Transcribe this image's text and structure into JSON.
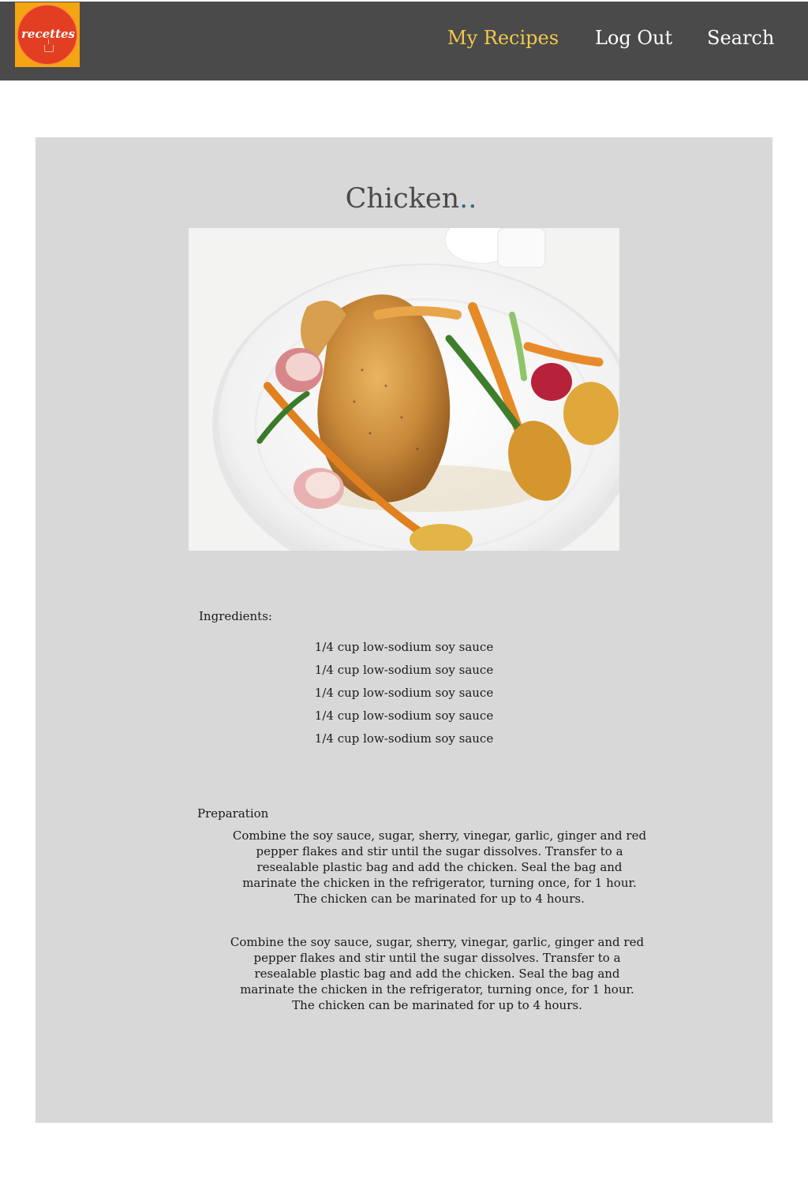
{
  "brand": {
    "logo_text": "recettes",
    "logo_bg": "#f5a511",
    "logo_circle": "#e23e21"
  },
  "nav": {
    "my_recipes": "My Recipes",
    "log_out": "Log Out",
    "search": "Search",
    "bar_color": "#4a4a4a",
    "active_color": "#f2c94c"
  },
  "recipe": {
    "title": "Chicken",
    "title_suffix": "..",
    "photo_icon": "roast-chicken-plate-photo",
    "ingredients_label": "Ingredients:",
    "ingredients": [
      "1/4 cup low-sodium soy sauce",
      "1/4 cup low-sodium soy sauce",
      "1/4 cup low-sodium soy sauce",
      "1/4 cup low-sodium soy sauce",
      "1/4 cup low-sodium soy sauce"
    ],
    "preparation_label": "Preparation",
    "preparation": [
      "Combine the soy sauce, sugar, sherry, vinegar, garlic, ginger and red pepper flakes and stir until the sugar dissolves. Transfer to a resealable plastic bag and add the chicken. Seal the bag and marinate the chicken in the refrigerator, turning once, for 1 hour. The chicken can be marinated for up to 4 hours.",
      "Combine the soy sauce, sugar, sherry, vinegar, garlic, ginger and red pepper flakes and stir until the sugar dissolves. Transfer to a resealable plastic bag and add the chicken. Seal the bag and marinate the chicken in the refrigerator, turning once, for 1 hour. The chicken can be marinated for up to 4 hours."
    ]
  }
}
